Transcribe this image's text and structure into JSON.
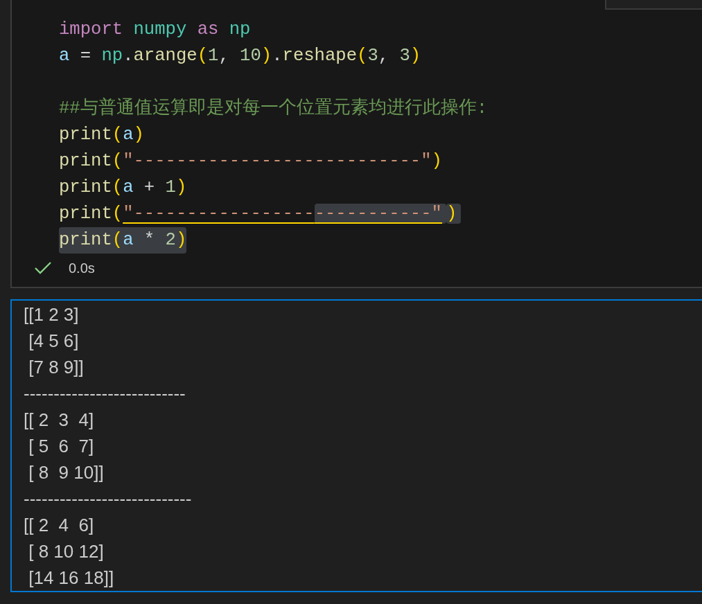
{
  "code_lines": [
    {
      "kind": "code",
      "highlighted": false,
      "tokens": [
        {
          "kind": "keyword",
          "text": "import "
        },
        {
          "kind": "module",
          "text": "numpy "
        },
        {
          "kind": "keyword",
          "text": "as "
        },
        {
          "kind": "module",
          "text": "np"
        }
      ]
    },
    {
      "kind": "code",
      "highlighted": false,
      "tokens": [
        {
          "kind": "variable",
          "text": "a"
        },
        {
          "kind": "plain",
          "text": " = "
        },
        {
          "kind": "module",
          "text": "np"
        },
        {
          "kind": "plain",
          "text": "."
        },
        {
          "kind": "function",
          "text": "arange"
        },
        {
          "kind": "bracket",
          "text": "("
        },
        {
          "kind": "number",
          "text": "1"
        },
        {
          "kind": "plain",
          "text": ", "
        },
        {
          "kind": "number",
          "text": "10"
        },
        {
          "kind": "bracket",
          "text": ")"
        },
        {
          "kind": "plain",
          "text": "."
        },
        {
          "kind": "function",
          "text": "reshape"
        },
        {
          "kind": "bracket",
          "text": "("
        },
        {
          "kind": "number",
          "text": "3"
        },
        {
          "kind": "plain",
          "text": ", "
        },
        {
          "kind": "number",
          "text": "3"
        },
        {
          "kind": "bracket",
          "text": ")"
        }
      ]
    },
    {
      "kind": "blank"
    },
    {
      "kind": "code",
      "highlighted": false,
      "tokens": [
        {
          "kind": "comment",
          "text": "##与普通值运算即是对每一个位置元素均进行此操作:"
        }
      ]
    },
    {
      "kind": "code",
      "highlighted": false,
      "tokens": [
        {
          "kind": "function",
          "text": "print"
        },
        {
          "kind": "bracket",
          "text": "("
        },
        {
          "kind": "variable",
          "text": "a"
        },
        {
          "kind": "bracket",
          "text": ")"
        }
      ]
    },
    {
      "kind": "code",
      "highlighted": false,
      "tokens": [
        {
          "kind": "function",
          "text": "print"
        },
        {
          "kind": "bracket",
          "text": "("
        },
        {
          "kind": "string",
          "text": "\"---------------------------\""
        },
        {
          "kind": "bracket",
          "text": ")"
        }
      ]
    },
    {
      "kind": "code",
      "highlighted": false,
      "tokens": [
        {
          "kind": "function",
          "text": "print"
        },
        {
          "kind": "bracket",
          "text": "("
        },
        {
          "kind": "variable",
          "text": "a"
        },
        {
          "kind": "plain",
          "text": " + "
        },
        {
          "kind": "number",
          "text": "1"
        },
        {
          "kind": "bracket",
          "text": ")"
        }
      ]
    },
    {
      "kind": "code",
      "highlighted": false,
      "tokens": [
        {
          "kind": "function",
          "text": "print"
        },
        {
          "kind": "bracket",
          "text": "("
        },
        {
          "kind": "string",
          "text": "\"-----------------",
          "underline": true,
          "highlight": false
        },
        {
          "kind": "string",
          "text": "-----------\"",
          "underline": true,
          "highlight": true
        },
        {
          "kind": "bracket",
          "text": ")",
          "underline": false,
          "highlight": true
        }
      ]
    },
    {
      "kind": "code",
      "highlighted": true,
      "tokens": [
        {
          "kind": "function",
          "text": "print"
        },
        {
          "kind": "bracket",
          "text": "("
        },
        {
          "kind": "variable",
          "text": "a"
        },
        {
          "kind": "plain",
          "text": " * "
        },
        {
          "kind": "number",
          "text": "2"
        },
        {
          "kind": "bracket",
          "text": ")"
        }
      ]
    }
  ],
  "status": {
    "succeeded": true,
    "duration": "0.0s"
  },
  "output_lines": [
    "[[1 2 3]",
    " [4 5 6]",
    " [7 8 9]]",
    "---------------------------",
    "[[ 2  3  4]",
    " [ 5  6  7]",
    " [ 8  9 10]]",
    "----------------------------",
    "[[ 2  4  6]",
    " [ 8 10 12]",
    " [14 16 18]]"
  ]
}
